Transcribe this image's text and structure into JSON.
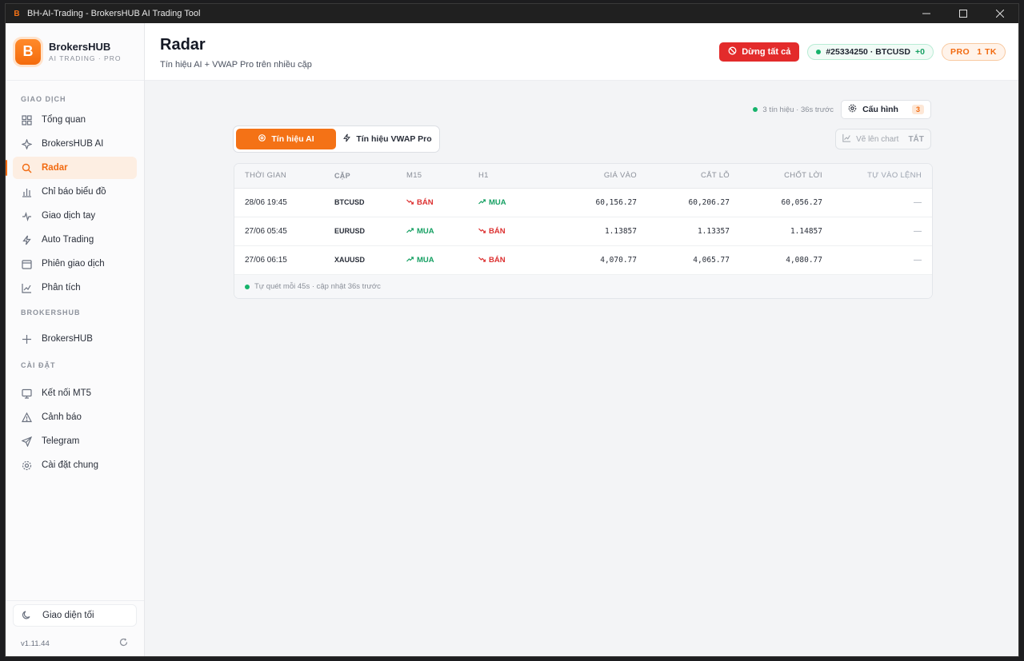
{
  "window": {
    "title": "BH-AI-Trading - BrokersHUB AI Trading Tool",
    "logo_letter": "B"
  },
  "brand": {
    "logo_letter": "B",
    "name": "BrokersHUB",
    "subtitle": "AI TRADING · PRO",
    "accent": "#f47216"
  },
  "sidebar": {
    "sections": [
      {
        "title": "GIAO DỊCH",
        "items": [
          {
            "label": "Tổng quan",
            "icon": "grid-icon"
          },
          {
            "label": "BrokersHUB AI",
            "icon": "sparkle-icon"
          },
          {
            "label": "Radar",
            "icon": "search-icon",
            "active": true
          },
          {
            "label": "Chỉ báo biểu đồ",
            "icon": "bar-chart-icon"
          },
          {
            "label": "Giao dịch tay",
            "icon": "pulse-icon"
          },
          {
            "label": "Auto Trading",
            "icon": "bolt-icon"
          },
          {
            "label": "Phiên giao dịch",
            "icon": "calendar-icon"
          },
          {
            "label": "Phân tích",
            "icon": "line-chart-icon"
          }
        ]
      },
      {
        "title": "BROKERSHUB",
        "items": [
          {
            "label": "BrokersHUB",
            "icon": "plus-icon"
          }
        ]
      },
      {
        "title": "CÀI ĐẶT",
        "items": [
          {
            "label": "Kết nối MT5",
            "icon": "monitor-icon"
          },
          {
            "label": "Cảnh báo",
            "icon": "warning-icon"
          },
          {
            "label": "Telegram",
            "icon": "send-icon"
          },
          {
            "label": "Cài đặt chung",
            "icon": "gear-icon"
          }
        ]
      }
    ],
    "theme_label": "Giao diện tối",
    "version": "v1.11.44"
  },
  "header": {
    "title": "Radar",
    "subtitle": "Tín hiệu AI + VWAP Pro trên nhiều cặp",
    "stop_all_label": "Dừng tất cả",
    "account": "#25334250 · BTCUSD",
    "account_pnl": "+0",
    "plan": "PRO",
    "plan_accounts": "1 TK"
  },
  "toolbar": {
    "status": "3 tín hiệu · 36s trước",
    "config_label": "Cấu hình",
    "config_count": "3",
    "tabs": [
      {
        "label": "Tín hiệu AI",
        "active": true
      },
      {
        "label": "Tín hiệu VWAP Pro",
        "active": false
      }
    ],
    "draw_label": "Vẽ lên chart",
    "draw_state": "TẮT"
  },
  "table": {
    "headers": [
      "THỜI GIAN",
      "CẶP",
      "M15",
      "H1",
      "GIÁ VÀO",
      "CẮT LỖ",
      "CHỐT LỜI",
      "TỰ VÀO LỆNH"
    ],
    "rows": [
      {
        "time": "28/06 19:45",
        "pair": "BTCUSD",
        "m15": "BÁN",
        "m15_dir": "sell",
        "h1": "MUA",
        "h1_dir": "buy",
        "entry": "60,156.27",
        "sl": "60,206.27",
        "tp": "60,056.27",
        "auto": "—"
      },
      {
        "time": "27/06 05:45",
        "pair": "EURUSD",
        "m15": "MUA",
        "m15_dir": "buy",
        "h1": "BÁN",
        "h1_dir": "sell",
        "entry": "1.13857",
        "sl": "1.13357",
        "tp": "1.14857",
        "auto": "—"
      },
      {
        "time": "27/06 06:15",
        "pair": "XAUUSD",
        "m15": "MUA",
        "m15_dir": "buy",
        "h1": "BÁN",
        "h1_dir": "sell",
        "entry": "4,070.77",
        "sl": "4,065.77",
        "tp": "4,080.77",
        "auto": "—"
      }
    ],
    "footer": "Tự quét mỗi 45s · cập nhật 36s trước"
  }
}
